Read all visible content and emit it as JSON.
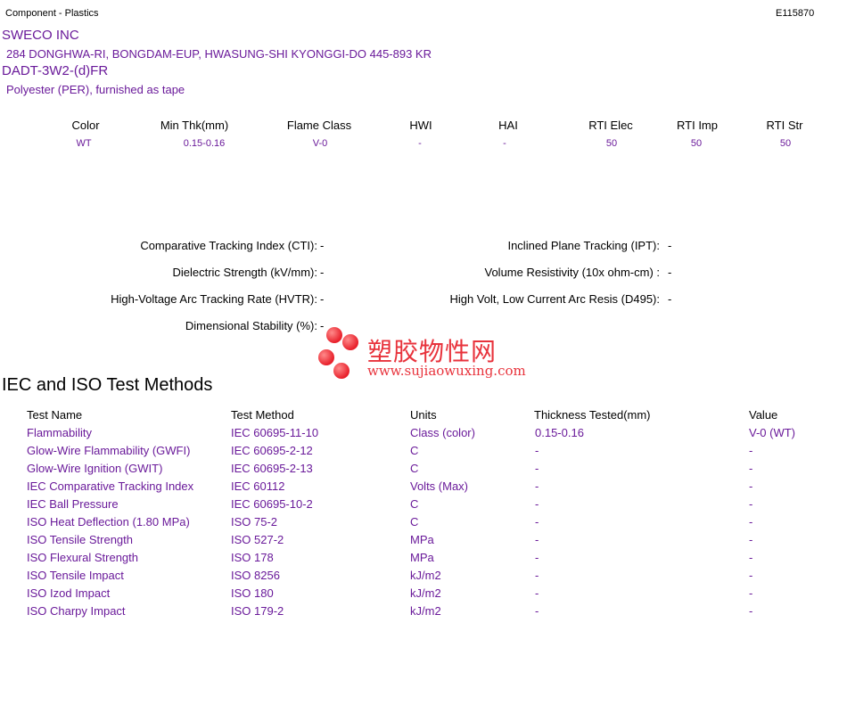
{
  "header": {
    "category": "Component - Plastics",
    "file_number": "E115870"
  },
  "company": {
    "name": "SWECO INC",
    "address": "284 DONGHWA-RI, BONGDAM-EUP, HWASUNG-SHI  KYONGGI-DO  445-893 KR"
  },
  "product": {
    "name": "DADT-3W2-(d)FR",
    "description": "Polyester (PER), furnished as tape"
  },
  "properties": {
    "headers": [
      "Color",
      "Min Thk(mm)",
      "Flame Class",
      "HWI",
      "HAI",
      "RTI Elec",
      "RTI Imp",
      "RTI Str"
    ],
    "values": [
      "WT",
      "0.15-0.16",
      "V-0",
      "-",
      "-",
      "50",
      "50",
      "50"
    ]
  },
  "electrical": {
    "left": [
      {
        "label": "Comparative Tracking Index (CTI):",
        "value": "-"
      },
      {
        "label": "Dielectric Strength (kV/mm):",
        "value": "-"
      },
      {
        "label": "High-Voltage Arc Tracking Rate (HVTR):",
        "value": "-"
      },
      {
        "label": "Dimensional Stability (%):",
        "value": "-"
      }
    ],
    "right": [
      {
        "label": "Inclined Plane Tracking (IPT):",
        "value": "-"
      },
      {
        "label": "Volume Resistivity (10x ohm-cm) :",
        "value": "-"
      },
      {
        "label": "High Volt, Low Current Arc Resis (D495):",
        "value": "-"
      }
    ]
  },
  "watermark": {
    "chinese": "塑胶物性网",
    "url": "www.sujiaowuxing.com"
  },
  "iec": {
    "title": "IEC and ISO Test Methods",
    "columns": [
      "Test Name",
      "Test Method",
      "Units",
      "Thickness Tested(mm)",
      "Value"
    ],
    "rows": [
      [
        "Flammability",
        "IEC 60695-11-10",
        "Class (color)",
        "0.15-0.16",
        "V-0 (WT)"
      ],
      [
        "Glow-Wire Flammability (GWFI)",
        "IEC 60695-2-12",
        "C",
        "-",
        "-"
      ],
      [
        "Glow-Wire Ignition (GWIT)",
        "IEC 60695-2-13",
        "C",
        "-",
        "-"
      ],
      [
        "IEC Comparative Tracking Index",
        "IEC 60112",
        "Volts (Max)",
        "-",
        "-"
      ],
      [
        "IEC Ball Pressure",
        "IEC 60695-10-2",
        "C",
        "-",
        "-"
      ],
      [
        "ISO Heat Deflection (1.80 MPa)",
        "ISO 75-2",
        "C",
        "-",
        "-"
      ],
      [
        "ISO Tensile Strength",
        "ISO 527-2",
        "MPa",
        "-",
        "-"
      ],
      [
        "ISO Flexural Strength",
        "ISO 178",
        "MPa",
        "-",
        "-"
      ],
      [
        "ISO Tensile Impact",
        "ISO 8256",
        "kJ/m2",
        "-",
        "-"
      ],
      [
        "ISO Izod Impact",
        "ISO 180",
        "kJ/m2",
        "-",
        "-"
      ],
      [
        "ISO Charpy Impact",
        "ISO 179-2",
        "kJ/m2",
        "-",
        "-"
      ]
    ]
  }
}
